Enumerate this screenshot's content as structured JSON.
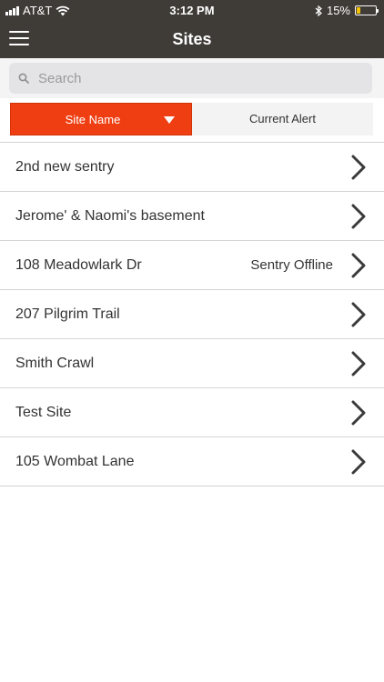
{
  "status_bar": {
    "carrier": "AT&T",
    "time": "3:12 PM",
    "battery": "15%",
    "battery_color": "#f3c200",
    "icons": [
      "signal-icon",
      "wifi-icon",
      "bluetooth-icon",
      "battery-icon"
    ]
  },
  "nav": {
    "title": "Sites",
    "menu_icon": "hamburger-menu-icon",
    "bar_color": "#3f3b37"
  },
  "search": {
    "placeholder": "Search",
    "value": "",
    "icon": "search-icon"
  },
  "sort": {
    "active_label": "Site Name",
    "active_icon": "caret-down-icon",
    "active_color": "#ef3e12",
    "inactive_label": "Current Alert"
  },
  "sites": [
    {
      "name": "2nd new sentry",
      "status": ""
    },
    {
      "name": "Jerome' & Naomi's basement",
      "status": ""
    },
    {
      "name": "108 Meadowlark Dr",
      "status": "Sentry Offline"
    },
    {
      "name": "207 Pilgrim Trail",
      "status": ""
    },
    {
      "name": "Smith Crawl",
      "status": ""
    },
    {
      "name": "Test Site",
      "status": ""
    },
    {
      "name": "105 Wombat Lane",
      "status": ""
    }
  ],
  "row_icon": "chevron-right-icon"
}
